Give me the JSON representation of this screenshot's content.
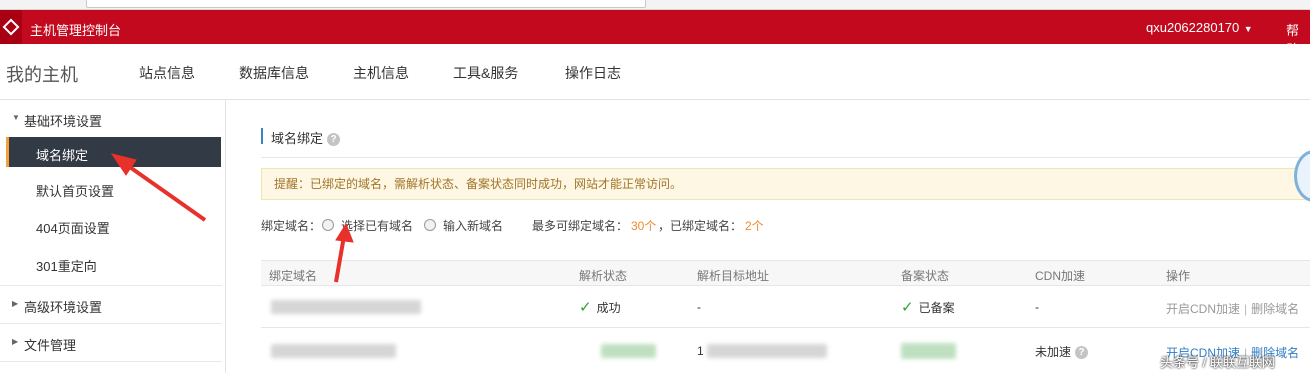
{
  "topbar": {
    "title": "主机管理控制台",
    "user": "qxu2062280170",
    "help": "帮助"
  },
  "nav": {
    "brand": "我的主机",
    "tabs": [
      "站点信息",
      "数据库信息",
      "主机信息",
      "工具&服务",
      "操作日志"
    ]
  },
  "sidebar": {
    "group1": "基础环境设置",
    "items": [
      "域名绑定",
      "默认首页设置",
      "404页面设置",
      "301重定向"
    ],
    "group2": "高级环境设置",
    "group3": "文件管理"
  },
  "main": {
    "section_title": "域名绑定",
    "notice": "提醒：已绑定的域名，需解析状态、备案状态同时成功，网站才能正常访问。",
    "bind_label": "绑定域名：",
    "opt_existing": "选择已有域名",
    "opt_new": "输入新域名",
    "limit_label": "最多可绑定域名：",
    "limit_value": "30个",
    "bound_label": "，已绑定域名：",
    "bound_value": "2个"
  },
  "table": {
    "headers": [
      "绑定域名",
      "解析状态",
      "解析目标地址",
      "备案状态",
      "CDN加速",
      "操作"
    ],
    "rows": [
      {
        "status": "成功",
        "target": "-",
        "icp": "已备案",
        "cdn": "-",
        "action_enable_cdn": "开启CDN加速",
        "action_delete": "删除域名"
      },
      {
        "target_prefix": "1",
        "cdn": "未加速",
        "action_enable_cdn": "开启CDN加速",
        "action_delete": "删除域名"
      }
    ]
  },
  "watermark": "头条号 / 联联互联网",
  "colors": {
    "topbar": "#c3091e",
    "active_item": "#323a45",
    "accent_orange": "#ef8a2c",
    "link_blue": "#2f7dc6",
    "success_green": "#2fa32f",
    "annotation_red": "#e8312a"
  }
}
